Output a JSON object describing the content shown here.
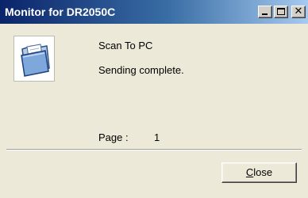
{
  "window": {
    "title": "Monitor for DR2050C",
    "controls": {
      "minimize_icon": "minimize-icon",
      "maximize_icon": "maximize-icon",
      "close_icon": "close-icon"
    }
  },
  "content": {
    "icon": "open-folder-document-icon",
    "scan_target": "Scan To PC",
    "status": "Sending complete.",
    "page_caption": "Page :",
    "page_value": "1"
  },
  "footer": {
    "close_label_accel": "C",
    "close_label_rest": "lose"
  },
  "colors": {
    "title_start": "#0a246a",
    "title_end": "#a6caf0",
    "background": "#ece9d8"
  }
}
